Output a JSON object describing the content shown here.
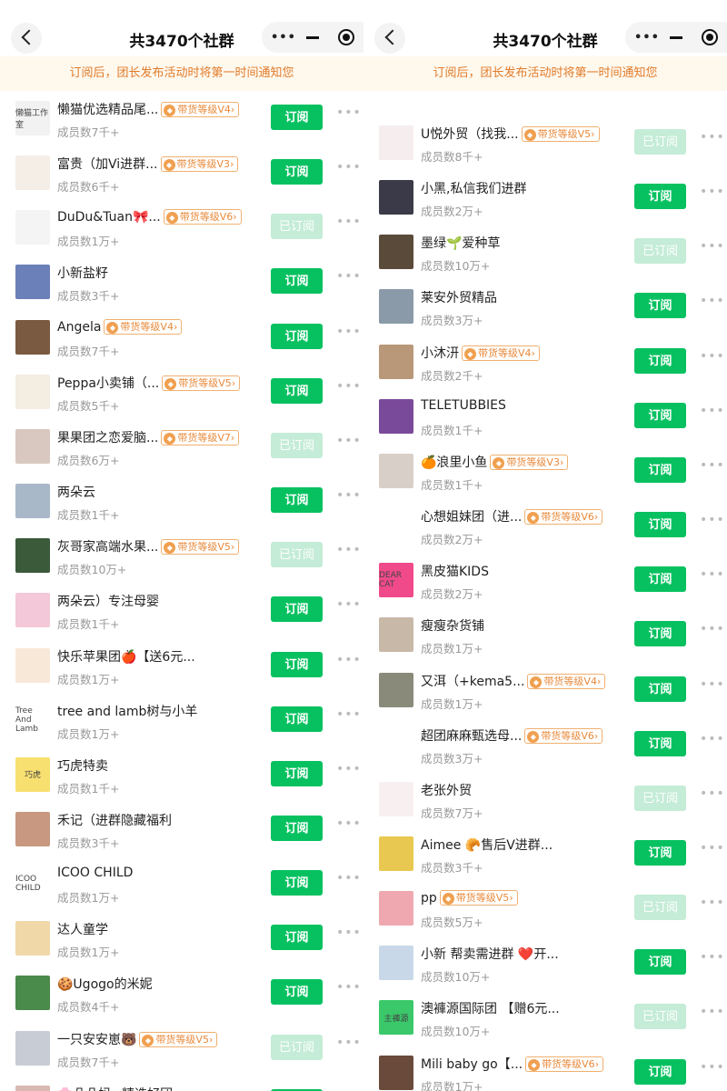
{
  "panes": [
    {
      "header": {
        "title": "共3470个社群"
      },
      "notice": "订阅后，团长发布活动时将第一时间通知您",
      "rows": [
        {
          "name": "懒猫优选精品尾...",
          "level": "带货等级V4",
          "count": "成员数7千+",
          "button": "订阅",
          "subscribed": false,
          "avatar_bg": "#f2f2f2",
          "avatar_text": "懒猫工作室"
        },
        {
          "name": "富贵（加Vi进群...",
          "level": "带货等级V3",
          "count": "成员数6千+",
          "button": "订阅",
          "subscribed": false,
          "avatar_bg": "#f5eee6",
          "avatar_text": ""
        },
        {
          "name": "DuDu&Tuan🎀...",
          "level": "带货等级V6",
          "count": "成员数1万+",
          "button": "已订阅",
          "subscribed": true,
          "avatar_bg": "#f4f4f4",
          "avatar_text": ""
        },
        {
          "name": "小新盐籽",
          "level": "",
          "count": "成员数3千+",
          "button": "订阅",
          "subscribed": false,
          "avatar_bg": "#6b7fb8",
          "avatar_text": ""
        },
        {
          "name": "Angela",
          "level": "带货等级V4",
          "count": "成员数7千+",
          "button": "订阅",
          "subscribed": false,
          "avatar_bg": "#7a5a40",
          "avatar_text": ""
        },
        {
          "name": "Peppa小卖铺（...",
          "level": "带货等级V5",
          "count": "成员数5千+",
          "button": "订阅",
          "subscribed": false,
          "avatar_bg": "#f3ede2",
          "avatar_text": ""
        },
        {
          "name": "果果团之恋爱脑...",
          "level": "带货等级V7",
          "count": "成员数6万+",
          "button": "已订阅",
          "subscribed": true,
          "avatar_bg": "#d8c8c0",
          "avatar_text": ""
        },
        {
          "name": "两朵云",
          "level": "",
          "count": "成员数1千+",
          "button": "订阅",
          "subscribed": false,
          "avatar_bg": "#a8b8c8",
          "avatar_text": ""
        },
        {
          "name": "灰哥家高端水果...",
          "level": "带货等级V5",
          "count": "成员数10万+",
          "button": "已订阅",
          "subscribed": true,
          "avatar_bg": "#3a5a3a",
          "avatar_text": ""
        },
        {
          "name": "两朵云）专注母婴",
          "level": "",
          "count": "成员数1千+",
          "button": "订阅",
          "subscribed": false,
          "avatar_bg": "#f3c8d8",
          "avatar_text": ""
        },
        {
          "name": "快乐苹果团🍎【送6元...",
          "level": "",
          "count": "成员数1万+",
          "button": "订阅",
          "subscribed": false,
          "avatar_bg": "#f8e8d8",
          "avatar_text": ""
        },
        {
          "name": "tree and lamb树与小羊",
          "level": "",
          "count": "成员数1万+",
          "button": "订阅",
          "subscribed": false,
          "avatar_bg": "#ffffff",
          "avatar_text": "Tree And Lamb"
        },
        {
          "name": "巧虎特卖",
          "level": "",
          "count": "成员数1千+",
          "button": "订阅",
          "subscribed": false,
          "avatar_bg": "#f8e070",
          "avatar_text": "巧虎"
        },
        {
          "name": "禾记（进群隐藏福利",
          "level": "",
          "count": "成员数3千+",
          "button": "订阅",
          "subscribed": false,
          "avatar_bg": "#c89880",
          "avatar_text": ""
        },
        {
          "name": "ICOO CHILD",
          "level": "",
          "count": "成员数1万+",
          "button": "订阅",
          "subscribed": false,
          "avatar_bg": "#ffffff",
          "avatar_text": "ICOO CHILD"
        },
        {
          "name": "达人童学",
          "level": "",
          "count": "成员数1万+",
          "button": "订阅",
          "subscribed": false,
          "avatar_bg": "#f0d8a8",
          "avatar_text": ""
        },
        {
          "name": "🍪Ugogo的米妮",
          "level": "",
          "count": "成员数4千+",
          "button": "订阅",
          "subscribed": false,
          "avatar_bg": "#4a8a4a",
          "avatar_text": ""
        },
        {
          "name": "一只安安崽🐻",
          "level": "带货等级V5",
          "count": "成员数7千+",
          "button": "已订阅",
          "subscribed": true,
          "avatar_bg": "#c8ccd4",
          "avatar_text": ""
        },
        {
          "name": "🌸朵朵妈~精选好团",
          "level": "",
          "count": "",
          "button": "订阅",
          "subscribed": false,
          "avatar_bg": "#d8b8b0",
          "avatar_text": ""
        }
      ]
    },
    {
      "header": {
        "title": "共3470个社群"
      },
      "notice": "订阅后，团长发布活动时将第一时间通知您",
      "rows": [
        {
          "name": "U悦外贸（找我...",
          "level": "带货等级V5",
          "count": "成员数8千+",
          "button": "已订阅",
          "subscribed": true,
          "avatar_bg": "#f6eeee",
          "avatar_text": ""
        },
        {
          "name": "小黑,私信我们进群",
          "level": "",
          "count": "成员数2万+",
          "button": "订阅",
          "subscribed": false,
          "avatar_bg": "#3a3a48",
          "avatar_text": ""
        },
        {
          "name": "墨绿🌱爱种草",
          "level": "",
          "count": "成员数10万+",
          "button": "已订阅",
          "subscribed": true,
          "avatar_bg": "#5a4a3a",
          "avatar_text": ""
        },
        {
          "name": "莱安外贸精品",
          "level": "",
          "count": "成员数3万+",
          "button": "订阅",
          "subscribed": false,
          "avatar_bg": "#8a9aa8",
          "avatar_text": ""
        },
        {
          "name": "小沐汧",
          "level": "带货等级V4",
          "count": "成员数2千+",
          "button": "订阅",
          "subscribed": false,
          "avatar_bg": "#b89878",
          "avatar_text": ""
        },
        {
          "name": "TELETUBBIES",
          "level": "",
          "count": "成员数1千+",
          "button": "订阅",
          "subscribed": false,
          "avatar_bg": "#7a4a9a",
          "avatar_text": ""
        },
        {
          "name": "🍊浪里小鱼",
          "level": "带货等级V3",
          "count": "成员数1千+",
          "button": "订阅",
          "subscribed": false,
          "avatar_bg": "#d8d0c8",
          "avatar_text": ""
        },
        {
          "name": "心想姐妹团（进...",
          "level": "带货等级V6",
          "count": "成员数2万+",
          "button": "订阅",
          "subscribed": false,
          "avatar_bg": "#ffffff",
          "avatar_text": ""
        },
        {
          "name": "黑皮猫KIDS",
          "level": "",
          "count": "成员数2万+",
          "button": "订阅",
          "subscribed": false,
          "avatar_bg": "#f04a8a",
          "avatar_text": "DEAR CAT"
        },
        {
          "name": "瘦瘦杂货铺",
          "level": "",
          "count": "成员数1万+",
          "button": "订阅",
          "subscribed": false,
          "avatar_bg": "#c8b8a8",
          "avatar_text": ""
        },
        {
          "name": "又洱（+kema5...",
          "level": "带货等级V4",
          "count": "成员数1万+",
          "button": "订阅",
          "subscribed": false,
          "avatar_bg": "#8a8a7a",
          "avatar_text": ""
        },
        {
          "name": "超团麻麻甄选母...",
          "level": "带货等级V6",
          "count": "成员数3万+",
          "button": "订阅",
          "subscribed": false,
          "avatar_bg": "#ffffff",
          "avatar_text": ""
        },
        {
          "name": "老张外贸",
          "level": "",
          "count": "成员数7万+",
          "button": "已订阅",
          "subscribed": true,
          "avatar_bg": "#f8f0f0",
          "avatar_text": ""
        },
        {
          "name": "Aimee 🥐售后V进群...",
          "level": "",
          "count": "成员数3千+",
          "button": "订阅",
          "subscribed": false,
          "avatar_bg": "#e8c850",
          "avatar_text": ""
        },
        {
          "name": "pp",
          "level": "带货等级V5",
          "count": "成员数5万+",
          "button": "已订阅",
          "subscribed": true,
          "avatar_bg": "#f0a8b0",
          "avatar_text": ""
        },
        {
          "name": "小新 帮卖需进群 ❤️开...",
          "level": "",
          "count": "成员数10万+",
          "button": "订阅",
          "subscribed": false,
          "avatar_bg": "#c8d8e8",
          "avatar_text": ""
        },
        {
          "name": "澳褲源国际团 【赠6元...",
          "level": "",
          "count": "成员数10万+",
          "button": "已订阅",
          "subscribed": true,
          "avatar_bg": "#3ac86a",
          "avatar_text": "主褲源"
        },
        {
          "name": "Mili baby go【...",
          "level": "带货等级V6",
          "count": "成员数1万+",
          "button": "订阅",
          "subscribed": false,
          "avatar_bg": "#6a4a3a",
          "avatar_text": ""
        }
      ]
    }
  ]
}
